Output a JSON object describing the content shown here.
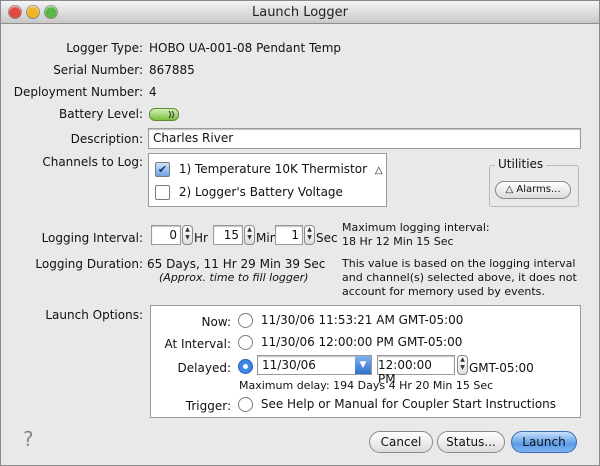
{
  "window": {
    "title": "Launch Logger"
  },
  "fields": {
    "logger_type_label": "Logger Type:",
    "logger_type_value": "HOBO UA-001-08 Pendant Temp",
    "serial_label": "Serial Number:",
    "serial_value": "867885",
    "deployment_label": "Deployment Number:",
    "deployment_value": "4",
    "battery_label": "Battery Level:",
    "description_label": "Description:",
    "description_value": "Charles River",
    "channels_label": "Channels to Log:"
  },
  "channels": [
    {
      "label": "1) Temperature 10K Thermistor",
      "checked": true
    },
    {
      "label": "2) Logger's Battery Voltage",
      "checked": false
    }
  ],
  "utilities": {
    "title": "Utilities",
    "alarms_button": "Alarms..."
  },
  "logging_interval": {
    "label": "Logging Interval:",
    "hr_value": "0",
    "hr_unit": "Hr",
    "min_value": "15",
    "min_unit": "Min",
    "sec_value": "1",
    "sec_unit": "Sec",
    "max_line1": "Maximum logging interval:",
    "max_line2": "18 Hr 12 Min 15 Sec"
  },
  "logging_duration": {
    "label": "Logging Duration:",
    "value": "65 Days, 11 Hr 29 Min 39 Sec",
    "note": "(Approx. time to fill logger)",
    "info_line1": "This value is based on the logging interval",
    "info_line2": "and channel(s) selected above, it does not",
    "info_line3": "account for memory used by events."
  },
  "launch_options": {
    "label": "Launch Options:",
    "now_label": "Now:",
    "now_value": "11/30/06 11:53:21 AM GMT-05:00",
    "interval_label": "At Interval:",
    "interval_value": "11/30/06 12:00:00 PM GMT-05:00",
    "delayed_label": "Delayed:",
    "delayed_date": "11/30/06",
    "delayed_time": "12:00:00 PM",
    "delayed_tz": "GMT-05:00",
    "max_delay": "Maximum delay: 194 Days  4 Hr 20 Min 15 Sec",
    "trigger_label": "Trigger:",
    "trigger_value": "See Help or Manual for Coupler Start Instructions",
    "selected": "Delayed"
  },
  "buttons": {
    "cancel": "Cancel",
    "status": "Status...",
    "launch": "Launch",
    "help": "?"
  }
}
